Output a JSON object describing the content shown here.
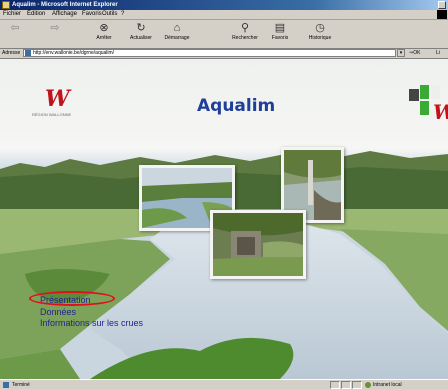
{
  "window": {
    "title": "Aqualim - Microsoft Internet Explorer"
  },
  "menu": {
    "items": [
      "Fichier",
      "Édition",
      "Affichage",
      "Favoris",
      "Outils",
      "?"
    ]
  },
  "toolbar": {
    "back_icon": "back-arrow-icon",
    "forward_icon": "forward-arrow-icon",
    "stop": "Arrêter",
    "refresh": "Actualiser",
    "home": "Démarrage",
    "search": "Rechercher",
    "favorites": "Favoris",
    "history": "Historique"
  },
  "address": {
    "label": "Adresse",
    "url": "http://env.wallonie.be/dgrne/aqualim/",
    "go": "OK",
    "links": "Li"
  },
  "page": {
    "title": "Aqualim",
    "logo_tagline": "RÉGION WALLONNE",
    "nav": {
      "presentation": "Présentation",
      "donnees": "Données",
      "crues": "Informations sur les crues"
    },
    "highlight_color": "#e0101a",
    "title_color": "#1f3f99",
    "link_color": "#23238e"
  },
  "status": {
    "text": "Terminé",
    "zone": "Intranet local"
  }
}
